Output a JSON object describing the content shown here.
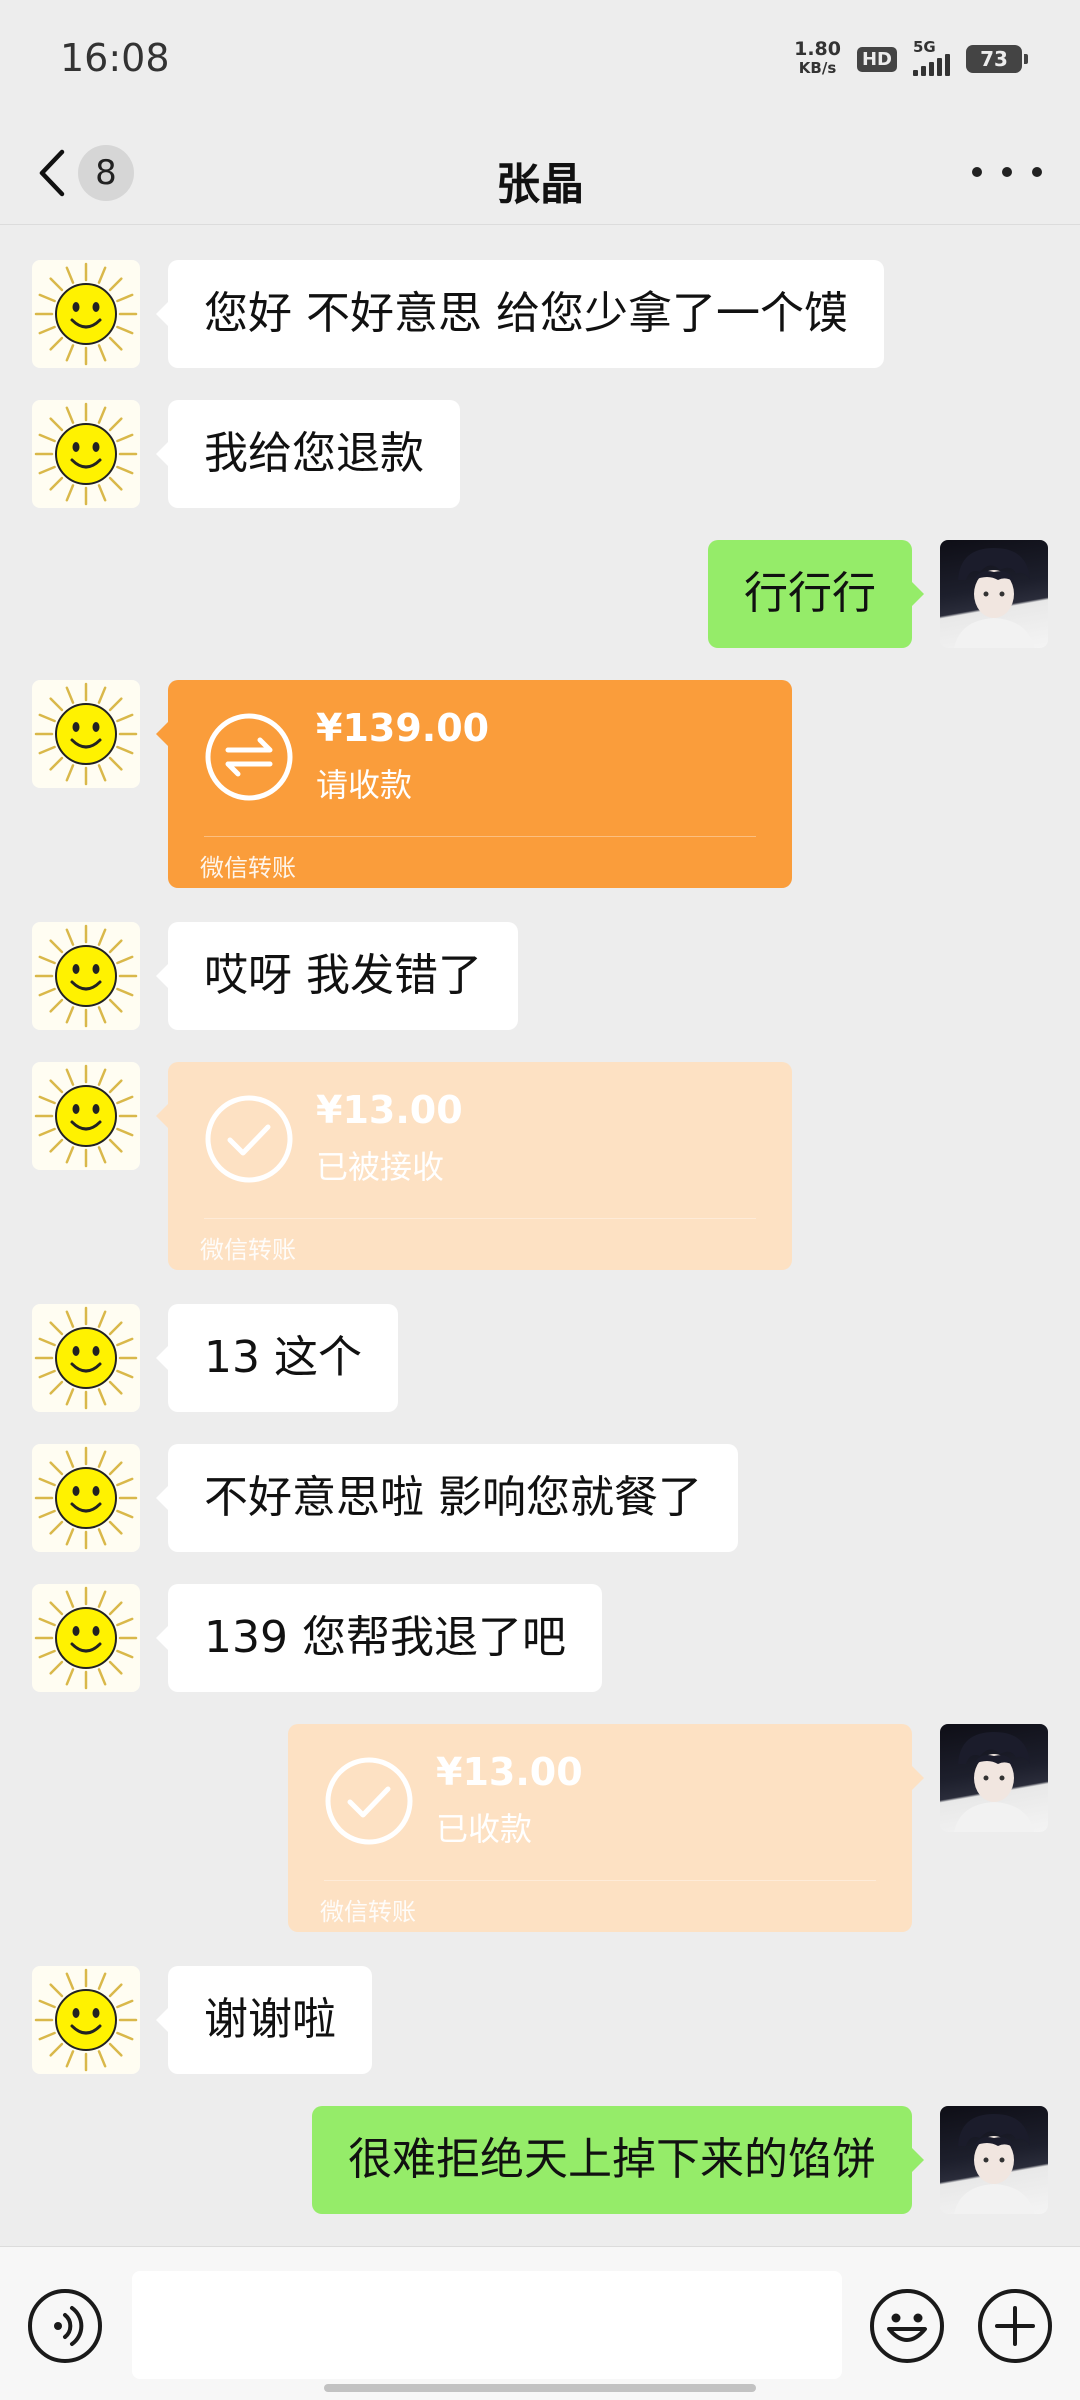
{
  "status_bar": {
    "time": "16:08",
    "net_speed_value": "1.80",
    "net_speed_unit": "KB/s",
    "hd_label": "HD",
    "signal_label": "5G",
    "battery": "73"
  },
  "header": {
    "unread_count": "8",
    "title": "张晶"
  },
  "messages": [
    {
      "side": "in",
      "type": "text",
      "text": "您好 不好意思 给您少拿了一个馍"
    },
    {
      "side": "in",
      "type": "text",
      "text": "我给您退款"
    },
    {
      "side": "out",
      "type": "text",
      "text": "行行行"
    },
    {
      "side": "in",
      "type": "transfer",
      "amount": "¥139.00",
      "status": "请收款",
      "footer": "微信转账"
    },
    {
      "side": "in",
      "type": "text",
      "text": "哎呀 我发错了"
    },
    {
      "side": "in",
      "type": "transfer",
      "amount": "¥13.00",
      "status": "已被接收",
      "footer": "微信转账"
    },
    {
      "side": "in",
      "type": "text",
      "text": "13 这个"
    },
    {
      "side": "in",
      "type": "text",
      "text": "不好意思啦 影响您就餐了"
    },
    {
      "side": "in",
      "type": "text",
      "text": "139 您帮我退了吧"
    },
    {
      "side": "out",
      "type": "transfer",
      "amount": "¥13.00",
      "status": "已收款",
      "footer": "微信转账"
    },
    {
      "side": "in",
      "type": "text",
      "text": "谢谢啦"
    },
    {
      "side": "out",
      "type": "text",
      "text": "很难拒绝天上掉下来的馅饼"
    }
  ],
  "input_bar": {
    "voice_icon": "voice-icon",
    "emoji_icon": "emoji-icon",
    "plus_icon": "plus-icon",
    "placeholder": ""
  },
  "colors": {
    "background": "#ededed",
    "incoming_bubble": "#ffffff",
    "outgoing_bubble": "#95ec69",
    "transfer_pending": "#fa9d3b",
    "transfer_done": "#fde1c3"
  }
}
